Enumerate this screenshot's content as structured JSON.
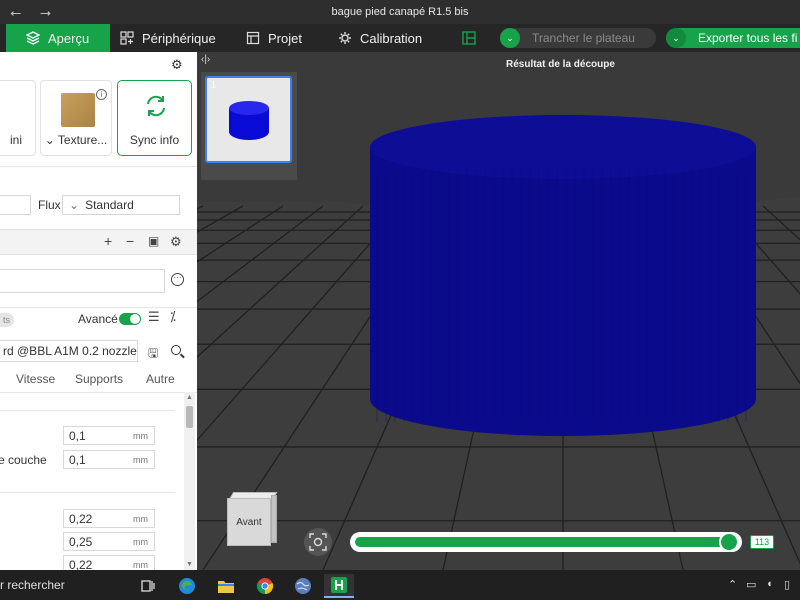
{
  "window": {
    "title": "bague pied canapé R1.5 bis",
    "back_glyph": "⭠",
    "forward_glyph": "⭢"
  },
  "menu": {
    "items": [
      {
        "label": "Aperçu",
        "icon": "cube-icon",
        "active": true
      },
      {
        "label": "Périphérique",
        "icon": "device-icon",
        "active": false
      },
      {
        "label": "Projet",
        "icon": "project-icon",
        "active": false
      },
      {
        "label": "Calibration",
        "icon": "calibration-icon",
        "active": false
      }
    ],
    "slice_label": "Trancher le plateau",
    "export_label": "Exporter tous les fi",
    "caret": "⌄"
  },
  "slice_result": {
    "label": "Résultat de la découpe"
  },
  "left_panel": {
    "plate_cards": {
      "first_label": "ini",
      "texture_label": "Texture...",
      "sync_label": "Sync info",
      "dropdown_glyph": "⌄",
      "info_glyph": "i"
    },
    "flux": {
      "label": "Flux",
      "value": "Standard"
    },
    "process": {
      "preset": "rd @BBL A1M 0.2 nozzle",
      "advanced_label": "Avancé",
      "advanced_on": true,
      "chip_text": "ts"
    },
    "tabs": [
      "Vitesse",
      "Supports",
      "Autre"
    ],
    "fields": {
      "layer_label": "e couche",
      "values": [
        {
          "value": "0,1",
          "unit": "mm"
        },
        {
          "value": "0,1",
          "unit": "mm"
        },
        {
          "value": "0,22",
          "unit": "mm"
        },
        {
          "value": "0,25",
          "unit": "mm"
        },
        {
          "value": "0,22",
          "unit": "mm"
        }
      ]
    }
  },
  "viewport": {
    "plate_number": "1",
    "view_cube_label": "Avant",
    "layer_value": "113",
    "layer_progress": 0.985,
    "model_color": "#0a0a8c",
    "accent": "#16a34a"
  },
  "taskbar": {
    "search_text": "r rechercher",
    "apps": [
      "task-view-icon",
      "edge-icon",
      "file-explorer-icon",
      "chrome-icon",
      "globe-icon",
      "bambu-studio-icon"
    ]
  }
}
